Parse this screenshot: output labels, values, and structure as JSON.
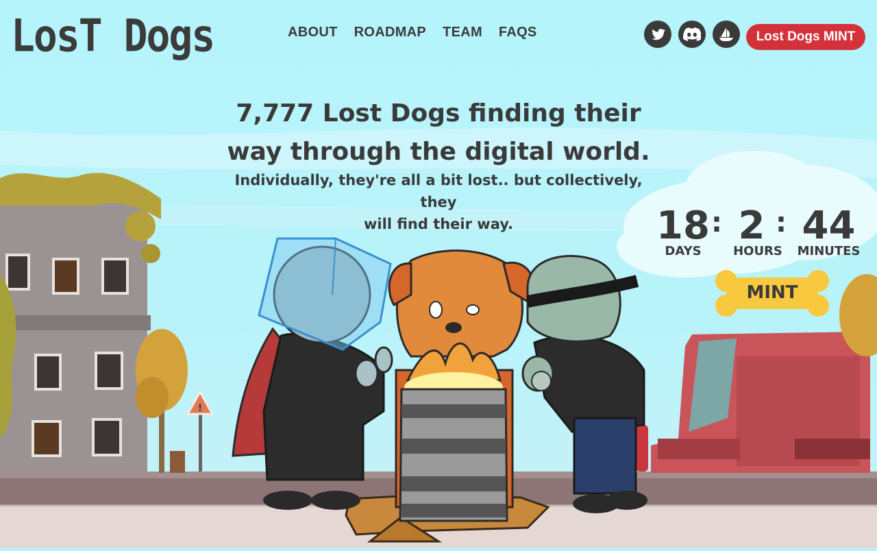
{
  "logo": {
    "text": "LosT Dogs"
  },
  "nav": {
    "items": [
      {
        "label": "ABOUT"
      },
      {
        "label": "ROADMAP"
      },
      {
        "label": "TEAM"
      },
      {
        "label": "FAQS"
      }
    ]
  },
  "social": {
    "icons": [
      "twitter-icon",
      "discord-icon",
      "opensea-icon"
    ]
  },
  "header": {
    "mint_button_label": "Lost Dogs MINT"
  },
  "hero": {
    "headline_line1": "7,777 Lost Dogs finding their",
    "headline_line2": "way through the digital world.",
    "sub_line1": "Individually, they're all a bit lost.. but collectively, they",
    "sub_line2": "will find their way."
  },
  "countdown": {
    "days": "18",
    "days_label": "DAYS",
    "hours": "2",
    "hours_label": "HOURS",
    "minutes": "44",
    "minutes_label": "MINUTES"
  },
  "mint_bone": {
    "label": "MINT"
  },
  "colors": {
    "sky": "#b6f4fb",
    "accent_red": "#d5313a",
    "bone_yellow": "#f8c93e",
    "text_dark": "#3a3a3a"
  }
}
